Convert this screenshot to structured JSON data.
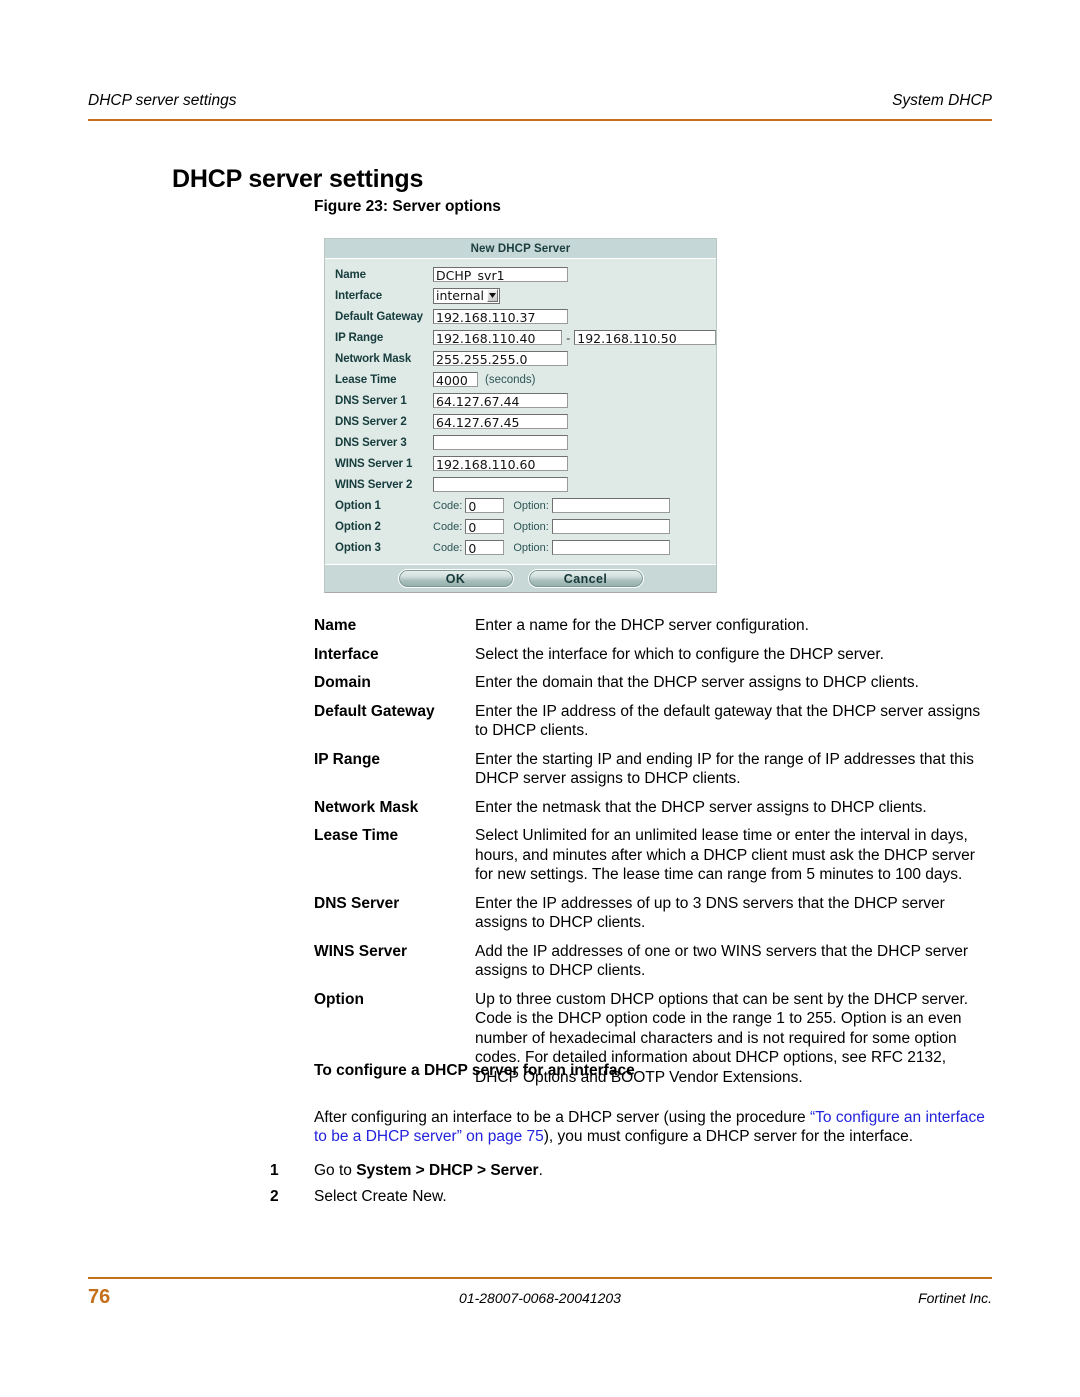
{
  "header": {
    "left": "DHCP server settings",
    "right": "System DHCP",
    "rule_color": "#C4701A"
  },
  "page_title": "DHCP server settings",
  "figure": {
    "caption": "Figure 23: Server options",
    "dialog": {
      "titlebar": "New DHCP Server",
      "fields": {
        "name_label": "Name",
        "name_value": "DCHP_svr1",
        "interface_label": "Interface",
        "interface_value": "internal",
        "gateway_label": "Default Gateway",
        "gateway_value": "192.168.110.37",
        "iprange_label": "IP Range",
        "iprange_start": "192.168.110.40",
        "iprange_separator": "-",
        "iprange_end": "192.168.110.50",
        "netmask_label": "Network Mask",
        "netmask_value": "255.255.255.0",
        "lease_label": "Lease Time",
        "lease_value": "4000",
        "lease_unit": "(seconds)",
        "dns1_label": "DNS Server 1",
        "dns1_value": "64.127.67.44",
        "dns2_label": "DNS Server 2",
        "dns2_value": "64.127.67.45",
        "dns3_label": "DNS Server 3",
        "dns3_value": "",
        "wins1_label": "WINS Server 1",
        "wins1_value": "192.168.110.60",
        "wins2_label": "WINS Server 2",
        "wins2_value": "",
        "option1_label": "Option 1",
        "option2_label": "Option 2",
        "option3_label": "Option 3",
        "code_label": "Code:",
        "option_label": "Option:",
        "option1_code": "0",
        "option1_value": "",
        "option2_code": "0",
        "option2_value": "",
        "option3_code": "0",
        "option3_value": ""
      },
      "buttons": {
        "ok": "OK",
        "cancel": "Cancel"
      }
    }
  },
  "definitions": [
    {
      "term": "Name",
      "desc": "Enter a name for the DHCP server configuration."
    },
    {
      "term": "Interface",
      "desc": "Select the interface for which to configure the DHCP server."
    },
    {
      "term": "Domain",
      "desc": "Enter the domain that the DHCP server assigns to DHCP clients."
    },
    {
      "term": "Default Gateway",
      "desc": "Enter the IP address of the default gateway that the DHCP server assigns to DHCP clients."
    },
    {
      "term": "IP Range",
      "desc": "Enter the starting IP and ending IP for the range of IP addresses that this DHCP server assigns to DHCP clients."
    },
    {
      "term": "Network Mask",
      "desc": "Enter the netmask that the DHCP server assigns to DHCP clients."
    },
    {
      "term": "Lease Time",
      "desc": "Select Unlimited for an unlimited lease time or enter the interval in days, hours, and minutes after which a DHCP client must ask the DHCP server for new settings. The lease time can range from 5 minutes to 100 days."
    },
    {
      "term": "DNS Server",
      "desc": "Enter the IP addresses of up to 3 DNS servers that the DHCP server assigns to DHCP clients."
    },
    {
      "term": "WINS Server",
      "desc": "Add the IP addresses of one or two WINS servers that the DHCP server assigns to DHCP clients."
    },
    {
      "term": "Option",
      "desc": "Up to three custom DHCP options that can be sent by the DHCP server. Code is the DHCP option code in the range 1 to 255. Option is an even number of hexadecimal characters and is not required for some option codes. For detailed information about DHCP options, see RFC 2132, DHCP Options and BOOTP Vendor Extensions."
    }
  ],
  "procedure": {
    "heading": "To configure a DHCP server for an interface",
    "intro_before": "After configuring an interface to be a DHCP server (using the procedure ",
    "intro_link": "“To configure an interface to be a DHCP server” on page 75",
    "intro_after": "), you must configure a DHCP server for the interface.",
    "link_color": "#2222DD",
    "steps": [
      {
        "num": "1",
        "before": "Go to ",
        "bold": "System > DHCP > Server",
        "after": "."
      },
      {
        "num": "2",
        "before": "Select Create New.",
        "bold": "",
        "after": ""
      }
    ]
  },
  "footer": {
    "page_number": "76",
    "doc_number": "01-28007-0068-20041203",
    "company": "Fortinet Inc."
  }
}
